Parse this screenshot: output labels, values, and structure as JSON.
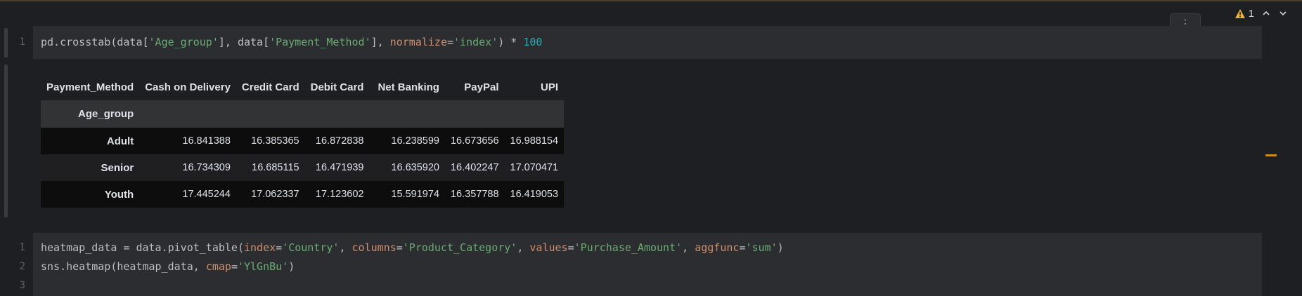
{
  "toolbar": {
    "warning_count": "1"
  },
  "cell1": {
    "line_numbers": [
      "1"
    ],
    "code_tokens": [
      {
        "t": "pd.crosstab(data[",
        "c": "op"
      },
      {
        "t": "'Age_group'",
        "c": "str"
      },
      {
        "t": "], data[",
        "c": "op"
      },
      {
        "t": "'Payment_Method'",
        "c": "str"
      },
      {
        "t": "], ",
        "c": "op"
      },
      {
        "t": "normalize",
        "c": "kw"
      },
      {
        "t": "=",
        "c": "op"
      },
      {
        "t": "'index'",
        "c": "str"
      },
      {
        "t": ") * ",
        "c": "op"
      },
      {
        "t": "100",
        "c": "num"
      }
    ]
  },
  "output": {
    "columns_name": "Payment_Method",
    "columns": [
      "Cash on Delivery",
      "Credit Card",
      "Debit Card",
      "Net Banking",
      "PayPal",
      "UPI"
    ],
    "index_name": "Age_group",
    "rows": [
      {
        "label": "Adult",
        "values": [
          "16.841388",
          "16.385365",
          "16.872838",
          "16.238599",
          "16.673656",
          "16.988154"
        ]
      },
      {
        "label": "Senior",
        "values": [
          "16.734309",
          "16.685115",
          "16.471939",
          "16.635920",
          "16.402247",
          "17.070471"
        ]
      },
      {
        "label": "Youth",
        "values": [
          "17.445244",
          "17.062337",
          "17.123602",
          "15.591974",
          "16.357788",
          "16.419053"
        ]
      }
    ]
  },
  "cell2": {
    "line_numbers": [
      "1",
      "2",
      "3"
    ],
    "lines": [
      [
        {
          "t": "heatmap_data = data.pivot_table(",
          "c": "op"
        },
        {
          "t": "index",
          "c": "kw"
        },
        {
          "t": "=",
          "c": "op"
        },
        {
          "t": "'Country'",
          "c": "str"
        },
        {
          "t": ", ",
          "c": "op"
        },
        {
          "t": "columns",
          "c": "kw"
        },
        {
          "t": "=",
          "c": "op"
        },
        {
          "t": "'Product_Category'",
          "c": "str"
        },
        {
          "t": ", ",
          "c": "op"
        },
        {
          "t": "values",
          "c": "kw"
        },
        {
          "t": "=",
          "c": "op"
        },
        {
          "t": "'Purchase_Amount'",
          "c": "str"
        },
        {
          "t": ", ",
          "c": "op"
        },
        {
          "t": "aggfunc",
          "c": "kw"
        },
        {
          "t": "=",
          "c": "op"
        },
        {
          "t": "'sum'",
          "c": "str"
        },
        {
          "t": ")",
          "c": "op"
        }
      ],
      [
        {
          "t": "sns.heatmap(heatmap_data, ",
          "c": "op"
        },
        {
          "t": "cmap",
          "c": "kw"
        },
        {
          "t": "=",
          "c": "op"
        },
        {
          "t": "'YlGnBu'",
          "c": "str"
        },
        {
          "t": ")",
          "c": "op"
        }
      ],
      []
    ]
  },
  "icons": {
    "warning": "warning-icon",
    "up": "chevron-up-icon",
    "down": "chevron-down-icon",
    "menu": "kebab-menu-icon"
  },
  "colors": {
    "keyword": "#cf8e6d",
    "string": "#6aab73",
    "number": "#2aacb8",
    "warning": "#e8b341"
  }
}
